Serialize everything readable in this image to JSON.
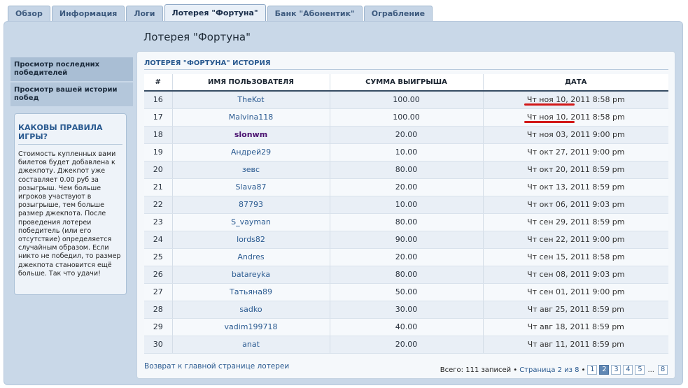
{
  "tabs": [
    {
      "label": "Обзор",
      "active": false
    },
    {
      "label": "Информация",
      "active": false
    },
    {
      "label": "Логи",
      "active": false
    },
    {
      "label": "Лотерея \"Фортуна\"",
      "active": true
    },
    {
      "label": "Банк \"Абонентик\"",
      "active": false
    },
    {
      "label": "Ограбление",
      "active": false
    }
  ],
  "page_title": "Лотерея \"Фортуна\"",
  "sidebar": {
    "nav": [
      "Просмотр последних победителей",
      "Просмотр вашей истории побед"
    ],
    "rules_title": "КАКОВЫ ПРАВИЛА ИГРЫ?",
    "rules_text": "Стоимость купленных вами билетов будет добавлена к джекпоту. Джекпот уже составляет 0.00 руб за розыгрыш. Чем больше игроков участвуют в розыгрыше, тем больше размер джекпота. После проведения лотереи победитель (или его отсутствие) определяется случайным образом. Если никто не победил, то размер джекпота становится ещё больше. Так что удачи!"
  },
  "history": {
    "title": "ЛОТЕРЕЯ \"ФОРТУНА\" ИСТОРИЯ",
    "columns": [
      "#",
      "ИМЯ ПОЛЬЗОВАТЕЛЯ",
      "СУММА ВЫИГРЫША",
      "ДАТА"
    ],
    "rows": [
      {
        "n": "16",
        "user": "TheKot",
        "amount": "100.00",
        "date": "Чт ноя 10, 2011 8:58 pm",
        "bold": false,
        "marked": true
      },
      {
        "n": "17",
        "user": "Malvina118",
        "amount": "100.00",
        "date": "Чт ноя 10, 2011 8:58 pm",
        "bold": false,
        "marked": true
      },
      {
        "n": "18",
        "user": "slonwm",
        "amount": "20.00",
        "date": "Чт ноя 03, 2011 9:00 pm",
        "bold": true,
        "marked": false
      },
      {
        "n": "19",
        "user": "Андрей29",
        "amount": "10.00",
        "date": "Чт окт 27, 2011 9:00 pm",
        "bold": false,
        "marked": false
      },
      {
        "n": "20",
        "user": "зевс",
        "amount": "80.00",
        "date": "Чт окт 20, 2011 8:59 pm",
        "bold": false,
        "marked": false
      },
      {
        "n": "21",
        "user": "Slava87",
        "amount": "20.00",
        "date": "Чт окт 13, 2011 8:59 pm",
        "bold": false,
        "marked": false
      },
      {
        "n": "22",
        "user": "87793",
        "amount": "10.00",
        "date": "Чт окт 06, 2011 9:03 pm",
        "bold": false,
        "marked": false
      },
      {
        "n": "23",
        "user": "S_vayman",
        "amount": "80.00",
        "date": "Чт сен 29, 2011 8:59 pm",
        "bold": false,
        "marked": false
      },
      {
        "n": "24",
        "user": "lords82",
        "amount": "90.00",
        "date": "Чт сен 22, 2011 9:00 pm",
        "bold": false,
        "marked": false
      },
      {
        "n": "25",
        "user": "Andres",
        "amount": "20.00",
        "date": "Чт сен 15, 2011 8:58 pm",
        "bold": false,
        "marked": false
      },
      {
        "n": "26",
        "user": "batareyka",
        "amount": "80.00",
        "date": "Чт сен 08, 2011 9:03 pm",
        "bold": false,
        "marked": false
      },
      {
        "n": "27",
        "user": "Татьяна89",
        "amount": "50.00",
        "date": "Чт сен 01, 2011 9:00 pm",
        "bold": false,
        "marked": false
      },
      {
        "n": "28",
        "user": "sadko",
        "amount": "30.00",
        "date": "Чт авг 25, 2011 8:59 pm",
        "bold": false,
        "marked": false
      },
      {
        "n": "29",
        "user": "vadim199718",
        "amount": "40.00",
        "date": "Чт авг 18, 2011 8:59 pm",
        "bold": false,
        "marked": false
      },
      {
        "n": "30",
        "user": "anat",
        "amount": "20.00",
        "date": "Чт авг 11, 2011 8:59 pm",
        "bold": false,
        "marked": false
      }
    ]
  },
  "footer": {
    "back_link": "Возврат к главной странице лотереи",
    "total": "Всего: 111 записей •",
    "page_info": "Страница 2 из 8",
    "sep": "•",
    "pages": [
      "1",
      "2",
      "3",
      "4",
      "5"
    ],
    "current_page": "2",
    "ellipsis": "...",
    "last_page": "8"
  },
  "colors": {
    "accent": "#2a5a90",
    "marker": "#d21818",
    "active_page": "#5f87b4"
  }
}
